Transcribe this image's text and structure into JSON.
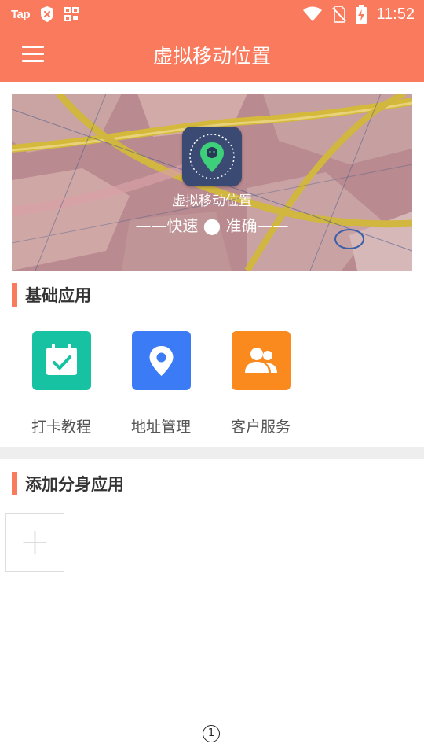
{
  "status_bar": {
    "carrier_text": "Tap",
    "time": "11:52",
    "icons": [
      "tap-logo-icon",
      "shield-x-icon",
      "qr-grid-icon",
      "wifi-icon",
      "no-sim-icon",
      "battery-charging-icon"
    ]
  },
  "header": {
    "title": "虚拟移动位置",
    "menu_icon": "hamburger-menu-icon"
  },
  "banner": {
    "app_name": "虚拟移动位置",
    "slogan": "——快速 ⬤ 准确——",
    "logo_icon": "location-pin-logo-icon"
  },
  "basic_apps": {
    "section_title": "基础应用",
    "items": [
      {
        "label": "打卡教程",
        "icon": "calendar-check-icon",
        "color": "#16c2a2"
      },
      {
        "label": "地址管理",
        "icon": "location-pin-icon",
        "color": "#3b7bf6"
      },
      {
        "label": "客户服务",
        "icon": "people-icon",
        "color": "#fa8a1e"
      }
    ]
  },
  "clone_apps": {
    "section_title": "添加分身应用",
    "add_icon": "plus-icon"
  },
  "bottom_marker": "1",
  "colors": {
    "accent": "#f97a5d",
    "divider": "#eeeeee"
  }
}
